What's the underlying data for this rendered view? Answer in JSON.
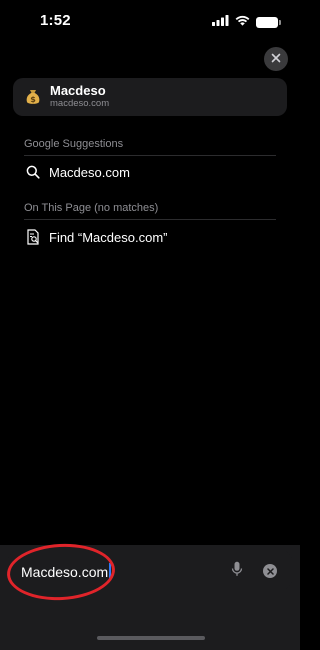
{
  "status_bar": {
    "time": "1:52",
    "icons": [
      "cellular-signal-icon",
      "wifi-icon",
      "battery-icon"
    ]
  },
  "close_button": {
    "icon": "close-icon"
  },
  "top_site": {
    "favicon": "money-bag-icon",
    "title": "Macdeso",
    "url": "macdeso.com"
  },
  "google_suggestions": {
    "header": "Google Suggestions",
    "items": [
      {
        "icon": "search-icon",
        "label": "Macdeso.com"
      }
    ]
  },
  "on_this_page": {
    "header": "On This Page (no matches)",
    "items": [
      {
        "icon": "find-in-page-icon",
        "label": "Find “Macdeso.com”"
      }
    ]
  },
  "address_bar": {
    "value": "Macdeso.com",
    "mic_icon": "microphone-icon",
    "clear_icon": "clear-icon"
  },
  "colors": {
    "background": "#000000",
    "card": "#1c1c1e",
    "secondary_text": "#8e8e93",
    "caret": "#2f7bf5",
    "annotation": "#e0242a"
  }
}
